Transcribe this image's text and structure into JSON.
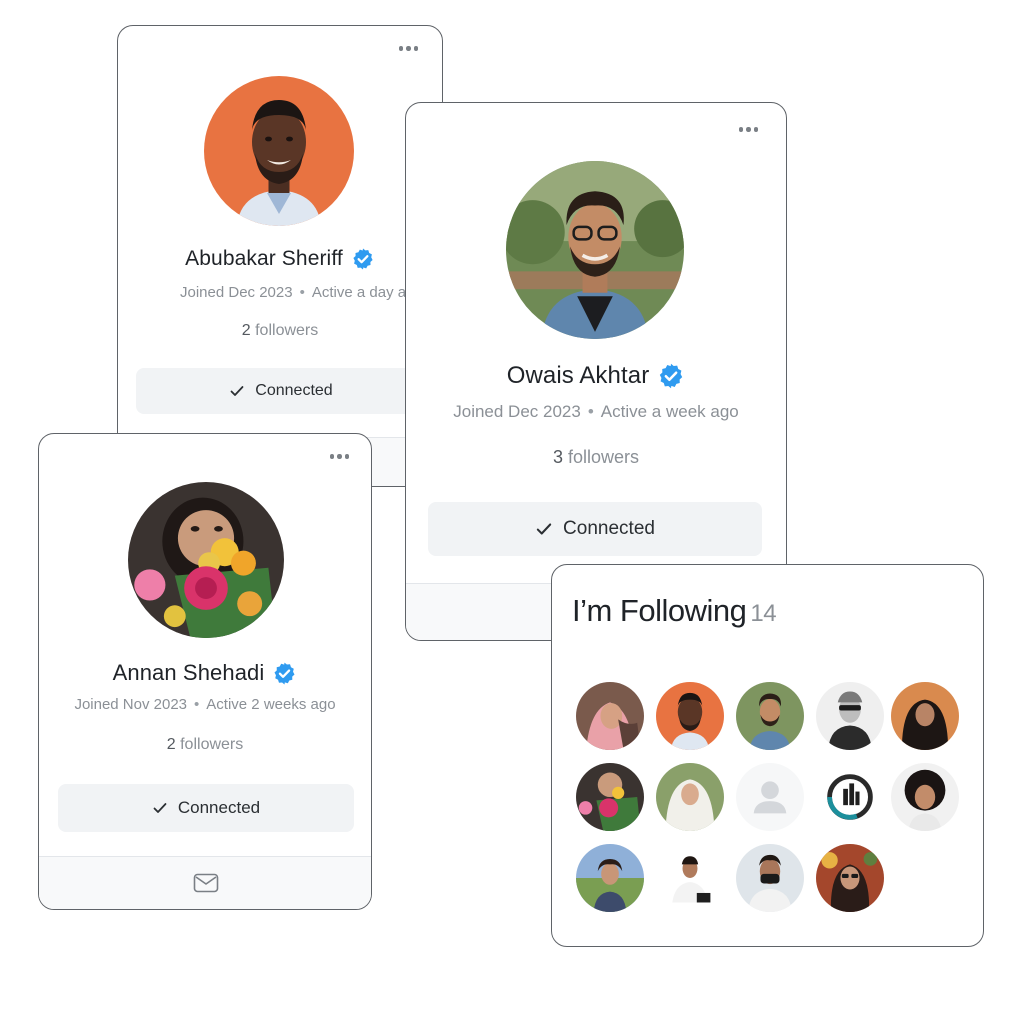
{
  "cards": [
    {
      "name": "Abubakar Sheriff",
      "joined": "Joined Dec 2023",
      "active": "Active a day ago",
      "followers_count": "2",
      "followers_label": "followers",
      "button_label": "Connected"
    },
    {
      "name": "Annan Shehadi",
      "joined": "Joined Nov 2023",
      "active": "Active 2 weeks ago",
      "followers_count": "2",
      "followers_label": "followers",
      "button_label": "Connected"
    },
    {
      "name": "Owais Akhtar",
      "joined": "Joined Dec 2023",
      "active": "Active a week ago",
      "followers_count": "3",
      "followers_label": "followers",
      "button_label": "Connected"
    }
  ],
  "following": {
    "title": "I’m Following",
    "count": "14"
  },
  "icons": {
    "more": "more-horizontal-icon",
    "verified": "verified-badge-icon",
    "check": "check-icon",
    "mail": "mail-icon",
    "default_user": "default-user-icon"
  },
  "colors": {
    "verified_blue": "#2f9bf0",
    "button_bg": "#f1f3f5",
    "muted_text": "#8b9096",
    "border": "#5f6368"
  }
}
